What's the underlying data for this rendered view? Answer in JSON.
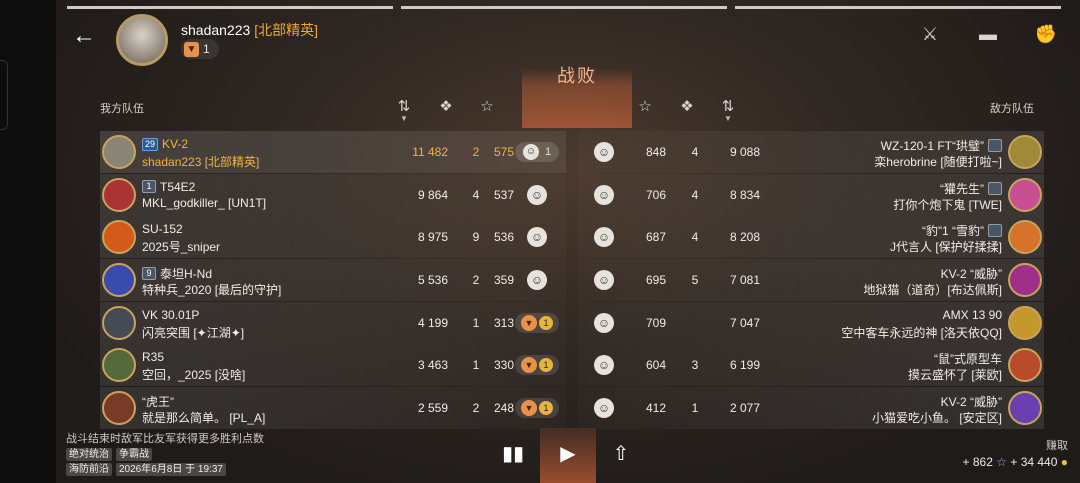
{
  "header": {
    "player_name": "shadan223",
    "player_clan": "[北部精英]",
    "dislike_count": "1",
    "result_title": "战败",
    "ally_team_label": "我方队伍",
    "enemy_team_label": "敌方队伍",
    "top_icons": [
      "crossed-swords-icon",
      "tank-icon",
      "fist-icon"
    ],
    "stat_icons": [
      "sort-icon",
      "kills-icon",
      "star-icon"
    ]
  },
  "allies": [
    {
      "level": "29",
      "tank": "KV-2",
      "player": "shadan223 [北部精英]",
      "damage": "11 482",
      "kills": "2",
      "xp": "575",
      "reaction": "like",
      "reaction_count": "1",
      "highlight": true
    },
    {
      "level": "1",
      "tank": "T54E2",
      "player": "MKL_godkiller_ [UN1T]",
      "damage": "9 864",
      "kills": "4",
      "xp": "537",
      "reaction": "face",
      "reaction_count": ""
    },
    {
      "level": "",
      "tank": "SU-152",
      "player": "2025号_sniper",
      "damage": "8 975",
      "kills": "9",
      "xp": "536",
      "reaction": "face",
      "reaction_count": ""
    },
    {
      "level": "9",
      "tank": "泰坦H-Nd",
      "player": "特种兵_2020 [最后的守护]",
      "damage": "5 536",
      "kills": "2",
      "xp": "359",
      "reaction": "face",
      "reaction_count": ""
    },
    {
      "level": "",
      "tank": "VK 30.01P",
      "player": "闪亮突围 [✦江湖✦]",
      "damage": "4 199",
      "kills": "1",
      "xp": "313",
      "reaction": "dislike",
      "reaction_count": "1"
    },
    {
      "level": "",
      "tank": "R35",
      "player": "空回，_2025 [没啥]",
      "damage": "3 463",
      "kills": "1",
      "xp": "330",
      "reaction": "dislike",
      "reaction_count": "1"
    },
    {
      "level": "",
      "tank": "“虎王”",
      "player": "就是那么简单。 [PL_A]",
      "damage": "2 559",
      "kills": "2",
      "xp": "248",
      "reaction": "dislike",
      "reaction_count": "1"
    }
  ],
  "enemies": [
    {
      "tank": "WZ-120-1 FT“珙璧”",
      "player": "栾herobrine [随便打啦~]",
      "xp": "848",
      "kills": "4",
      "damage": "9 088",
      "has_badge": true
    },
    {
      "tank": "“獾先生”",
      "player": "打你个炮下鬼 [TWE]",
      "xp": "706",
      "kills": "4",
      "damage": "8 834",
      "has_badge": true
    },
    {
      "tank": "“豹”1 “雪豹”",
      "player": "J代言人 [保护好揉揉]",
      "xp": "687",
      "kills": "4",
      "damage": "8 208",
      "has_badge": true
    },
    {
      "tank": "KV-2 “威胁”",
      "player": "地狱猫（道奇）[布达佩斯]",
      "xp": "695",
      "kills": "5",
      "damage": "7 081",
      "has_badge": false
    },
    {
      "tank": "AMX 13 90",
      "player": "空中客车永远的神 [洛天依QQ]",
      "xp": "709",
      "kills": "",
      "damage": "7 047",
      "has_badge": false
    },
    {
      "tank": "“鼠”式原型车",
      "player": "摸云盛怀了 [莱欧]",
      "xp": "604",
      "kills": "3",
      "damage": "6 199",
      "has_badge": false
    },
    {
      "tank": "KV-2 “威胁”",
      "player": "小猫爱吃小鱼。 [安定区]",
      "xp": "412",
      "kills": "1",
      "damage": "2 077",
      "has_badge": false
    }
  ],
  "footer": {
    "note": "战斗结束时敌军比友军获得更多胜利点数",
    "tag1": "绝对统治",
    "tag2": "争霸战",
    "tag3": "海防前沿",
    "date": "2026年6月8日 于 19:37",
    "earn_label": "赚取",
    "earn_xp": "+ 862",
    "earn_credits": "+ 34 440"
  },
  "colors": {
    "gold": "#f0b340",
    "defeat": "#e86e3c",
    "dislike": "#e8914a"
  }
}
